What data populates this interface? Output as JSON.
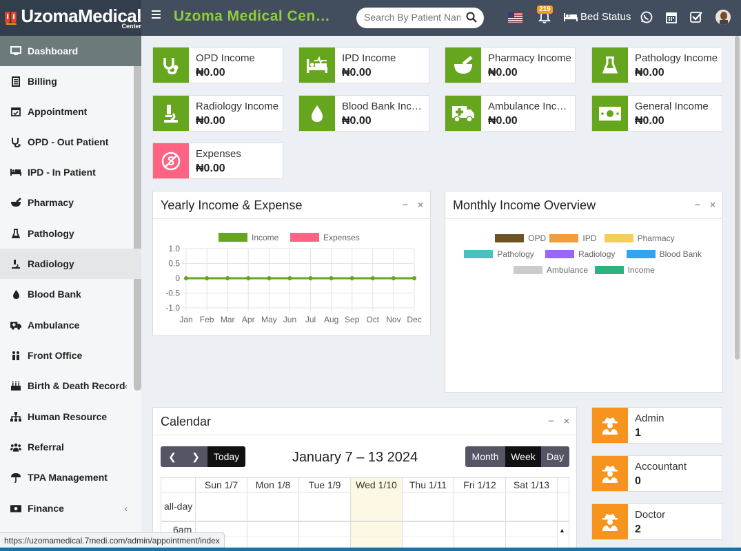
{
  "header": {
    "logo_text": "UzomaMedical",
    "logo_sub": "Center",
    "title": "Uzoma Medical Center",
    "search_placeholder": "Search By Patient Name",
    "notification_count": "219",
    "bed_status_label": "Bed Status"
  },
  "sidebar": {
    "items": [
      {
        "label": "Dashboard",
        "icon": "monitor-icon"
      },
      {
        "label": "Billing",
        "icon": "file-list-icon"
      },
      {
        "label": "Appointment",
        "icon": "calendar-check-icon"
      },
      {
        "label": "OPD - Out Patient",
        "icon": "stethoscope-icon"
      },
      {
        "label": "IPD - In Patient",
        "icon": "bed-icon"
      },
      {
        "label": "Pharmacy",
        "icon": "mortar-pestle-icon"
      },
      {
        "label": "Pathology",
        "icon": "flask-icon"
      },
      {
        "label": "Radiology",
        "icon": "microscope-icon"
      },
      {
        "label": "Blood Bank",
        "icon": "tint-icon"
      },
      {
        "label": "Ambulance",
        "icon": "ambulance-icon"
      },
      {
        "label": "Front Office",
        "icon": "users-icon"
      },
      {
        "label": "Birth & Death Record",
        "icon": "birthday-cake-icon"
      },
      {
        "label": "Human Resource",
        "icon": "sitemap-icon"
      },
      {
        "label": "Referral",
        "icon": "user-group-icon"
      },
      {
        "label": "TPA Management",
        "icon": "umbrella-icon"
      },
      {
        "label": "Finance",
        "icon": "money-bill-icon"
      }
    ]
  },
  "income_cards": [
    {
      "label": "OPD Income",
      "value": "₦0.00",
      "icon": "stethoscope-icon"
    },
    {
      "label": "IPD Income",
      "value": "₦0.00",
      "icon": "bed-pulse-icon"
    },
    {
      "label": "Pharmacy Income",
      "value": "₦0.00",
      "icon": "mortar-pestle-icon"
    },
    {
      "label": "Pathology Income",
      "value": "₦0.00",
      "icon": "flask-icon"
    },
    {
      "label": "Radiology Income",
      "value": "₦0.00",
      "icon": "microscope-icon"
    },
    {
      "label": "Blood Bank Income",
      "value": "₦0.00",
      "icon": "tint-icon"
    },
    {
      "label": "Ambulance Income",
      "value": "₦0.00",
      "icon": "ambulance-icon"
    },
    {
      "label": "General Income",
      "value": "₦0.00",
      "icon": "money-bill-icon"
    },
    {
      "label": "Expenses",
      "value": "₦0.00",
      "icon": "no-money-icon"
    }
  ],
  "yearly_panel": {
    "title": "Yearly Income & Expense"
  },
  "monthly_panel": {
    "title": "Monthly Income Overview"
  },
  "chart_data": [
    {
      "type": "line",
      "title": "Yearly Income & Expense",
      "x": [
        "Jan",
        "Feb",
        "Mar",
        "Apr",
        "May",
        "Jun",
        "Jul",
        "Aug",
        "Sep",
        "Oct",
        "Nov",
        "Dec"
      ],
      "series": [
        {
          "name": "Income",
          "color": "#66a61e",
          "values": [
            0,
            0,
            0,
            0,
            0,
            0,
            0,
            0,
            0,
            0,
            0,
            0
          ]
        },
        {
          "name": "Expenses",
          "color": "#ff6384",
          "values": [
            0,
            0,
            0,
            0,
            0,
            0,
            0,
            0,
            0,
            0,
            0,
            0
          ]
        }
      ],
      "yticks": [
        "1.0",
        "0.5",
        "0",
        "-0.5",
        "-1.0"
      ],
      "ylim": [
        -1,
        1
      ],
      "grid": true,
      "legend": "top"
    },
    {
      "type": "pie",
      "title": "Monthly Income Overview",
      "series": [
        {
          "name": "OPD",
          "color": "#6b5422",
          "value": 0
        },
        {
          "name": "IPD",
          "color": "#f39c3c",
          "value": 0
        },
        {
          "name": "Pharmacy",
          "color": "#f7cd5a",
          "value": 0
        },
        {
          "name": "Pathology",
          "color": "#4bc0c0",
          "value": 0
        },
        {
          "name": "Radiology",
          "color": "#9966ff",
          "value": 0
        },
        {
          "name": "Blood Bank",
          "color": "#36a2eb",
          "value": 0
        },
        {
          "name": "Ambulance",
          "color": "#c9cbcf",
          "value": 0
        },
        {
          "name": "Income",
          "color": "#2fb27e",
          "value": 0
        }
      ],
      "legend": "top"
    }
  ],
  "calendar": {
    "title": "Calendar",
    "today_label": "Today",
    "range_label": "January 7 – 13 2024",
    "views": [
      "Month",
      "Week",
      "Day"
    ],
    "days": [
      "Sun 1/7",
      "Mon 1/8",
      "Tue 1/9",
      "Wed 1/10",
      "Thu 1/11",
      "Fri 1/12",
      "Sat 1/13"
    ],
    "allday_label": "all-day",
    "time_label": "6am"
  },
  "staff_cards": [
    {
      "label": "Admin",
      "value": "1"
    },
    {
      "label": "Accountant",
      "value": "0"
    },
    {
      "label": "Doctor",
      "value": "2"
    }
  ],
  "status_url": "https://uzomamedical.7medi.com/admin/appointment/index",
  "colors": {
    "header": "#424e5e",
    "accent_green": "#66a61e",
    "title_green": "#8fce3a",
    "expense_pink": "#ff6384",
    "staff_orange": "#f7941d"
  }
}
